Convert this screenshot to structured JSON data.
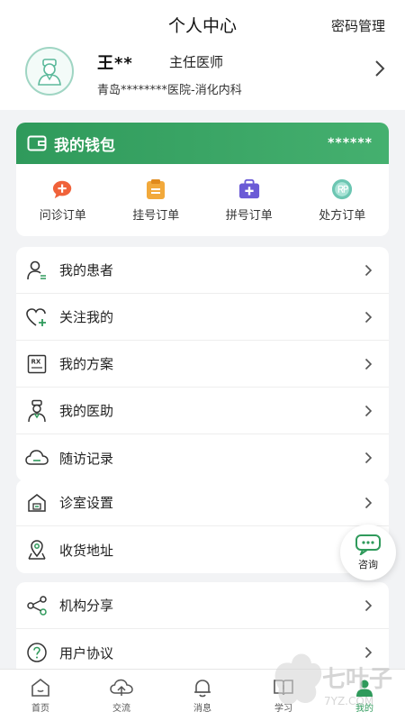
{
  "header": {
    "title": "个人中心",
    "password_link": "密码管理"
  },
  "profile": {
    "name": "王**",
    "role": "主任医师",
    "hospital": "青岛********医院-消化内科"
  },
  "wallet": {
    "title": "我的钱包",
    "balance_mask": "******",
    "orders": [
      {
        "label": "问诊订单",
        "icon": "consult-order-icon",
        "color": "#f0623a"
      },
      {
        "label": "挂号订单",
        "icon": "register-order-icon",
        "color": "#f2a93b"
      },
      {
        "label": "拼号订单",
        "icon": "group-order-icon",
        "color": "#6b5bd6"
      },
      {
        "label": "处方订单",
        "icon": "prescription-order-icon",
        "color": "#6cc6b2"
      }
    ]
  },
  "menu_group1": [
    {
      "label": "我的患者",
      "icon": "patient-icon"
    },
    {
      "label": "关注我的",
      "icon": "heart-plus-icon"
    },
    {
      "label": "我的方案",
      "icon": "rx-icon"
    },
    {
      "label": "我的医助",
      "icon": "doctor-assistant-icon"
    },
    {
      "label": "随访记录",
      "icon": "cloud-icon"
    }
  ],
  "menu_group2": [
    {
      "label": "诊室设置",
      "icon": "clinic-house-icon"
    },
    {
      "label": "收货地址",
      "icon": "location-icon"
    }
  ],
  "menu_group3": [
    {
      "label": "机构分享",
      "icon": "share-icon"
    },
    {
      "label": "用户协议",
      "icon": "question-icon"
    }
  ],
  "float_button": {
    "label": "咨询"
  },
  "tabbar": [
    {
      "label": "首页",
      "icon": "home-icon",
      "active": false
    },
    {
      "label": "交流",
      "icon": "cloud-exchange-icon",
      "active": false
    },
    {
      "label": "消息",
      "icon": "bell-icon",
      "active": false
    },
    {
      "label": "学习",
      "icon": "book-icon",
      "active": false
    },
    {
      "label": "我的",
      "icon": "user-icon",
      "active": true
    }
  ],
  "watermark": {
    "text": "七叶子",
    "subtext": "7YZ.COM"
  },
  "colors": {
    "brand_green": "#2f9a5b",
    "background": "#f2f3f5"
  }
}
